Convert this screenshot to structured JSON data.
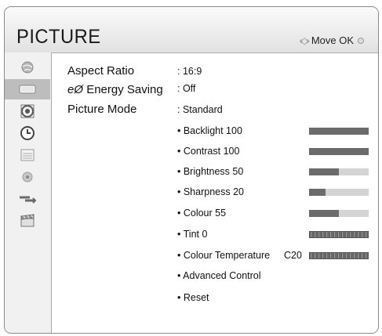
{
  "header": {
    "title": "PICTURE",
    "nav_hint": "Move OK"
  },
  "sidebar": {
    "items": [
      {
        "icon": "globe-icon"
      },
      {
        "icon": "monitor-icon",
        "active": true
      },
      {
        "icon": "speaker-icon"
      },
      {
        "icon": "clock-icon"
      },
      {
        "icon": "calendar-icon"
      },
      {
        "icon": "lock-icon"
      },
      {
        "icon": "input-icon"
      },
      {
        "icon": "clapboard-icon"
      }
    ]
  },
  "settings": {
    "aspect_ratio": {
      "label": "Aspect Ratio",
      "value": ": 16:9"
    },
    "energy_saving": {
      "icon_text": "eØ",
      "label": "Energy Saving",
      "value": ": Off"
    },
    "picture_mode": {
      "label": "Picture Mode",
      "value": ": Standard"
    },
    "sub_settings": [
      {
        "label": "• Backlight 100",
        "level": 1.0
      },
      {
        "label": "• Contrast 100",
        "level": 1.0
      },
      {
        "label": "• Brightness 50",
        "level": 0.5
      },
      {
        "label": "• Sharpness 20",
        "level": 0.27
      },
      {
        "label": "• Colour 55",
        "level": 0.5
      }
    ],
    "tint": {
      "label": "• Tint 0"
    },
    "colour_temperature": {
      "label": "• Colour Temperature",
      "value": "C20"
    },
    "advanced_control": {
      "label": "• Advanced Control"
    },
    "reset": {
      "label": "• Reset"
    }
  },
  "colors": {
    "bar_fill": "#6b6b6b",
    "bar_track": "#d4d4d4",
    "active_sidebar": "#bdbdbd"
  }
}
